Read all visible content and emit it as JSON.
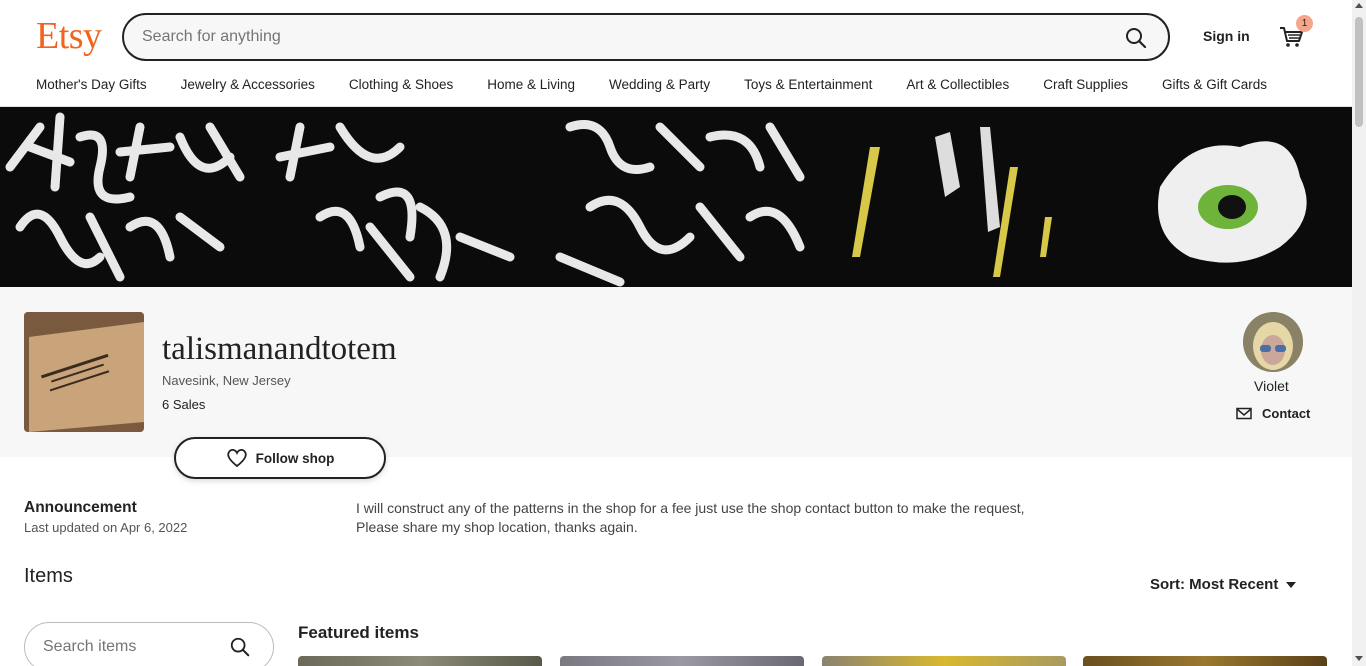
{
  "header": {
    "logo": "Etsy",
    "search_placeholder": "Search for anything",
    "signin_label": "Sign in",
    "cart_count": "1",
    "nav": [
      "Mother's Day Gifts",
      "Jewelry & Accessories",
      "Clothing & Shoes",
      "Home & Living",
      "Wedding & Party",
      "Toys & Entertainment",
      "Art & Collectibles",
      "Craft Supplies",
      "Gifts & Gift Cards"
    ]
  },
  "shop": {
    "name": "talismanandtotem",
    "location": "Navesink, New Jersey",
    "sales": "6 Sales",
    "follow_label": "Follow shop",
    "owner_name": "Violet",
    "contact_label": "Contact"
  },
  "announcement": {
    "title": "Announcement",
    "updated": "Last updated on Apr 6, 2022",
    "text_line1": "I will construct any of the patterns in the shop for a fee just use the shop contact button to make the request,",
    "text_line2": "Please share my shop location, thanks again."
  },
  "items": {
    "title": "Items",
    "sort_label": "Sort: Most Recent",
    "search_placeholder": "Search items",
    "featured_title": "Featured items"
  },
  "colors": {
    "brand": "#F1641E",
    "text": "#222222",
    "section_bg": "#f7f7f7",
    "banner_bg": "#0b0b0b"
  }
}
